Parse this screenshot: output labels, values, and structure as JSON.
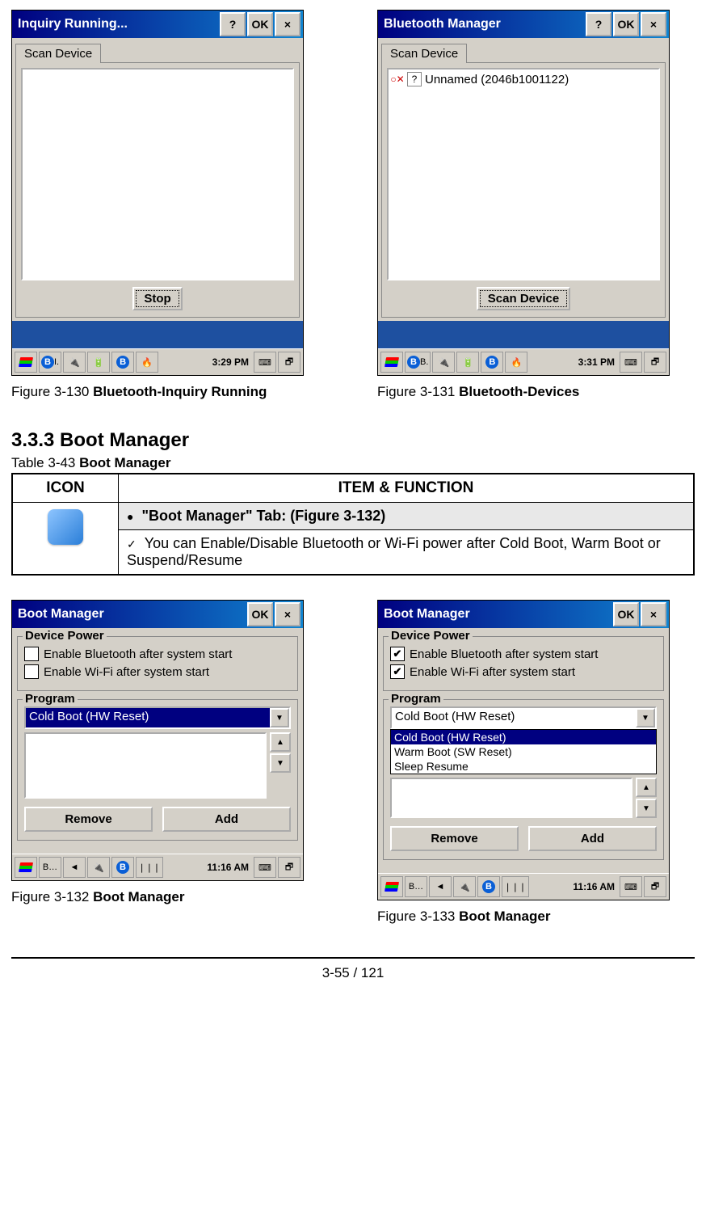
{
  "figures_top": {
    "left": {
      "title": "Inquiry Running...",
      "tab": "Scan Device",
      "main_button": "Stop",
      "time": "3:29 PM",
      "taskbar_text": "I.",
      "caption_prefix": "Figure 3-130 ",
      "caption_bold": "Bluetooth-Inquiry Running"
    },
    "right": {
      "title": "Bluetooth Manager",
      "tab": "Scan Device",
      "list_item": "Unnamed (2046b1001122)",
      "main_button": "Scan Device",
      "time": "3:31 PM",
      "taskbar_text": "B.",
      "caption_prefix": "Figure 3-131 ",
      "caption_bold": "Bluetooth-Devices"
    },
    "btn_help": "?",
    "btn_ok": "OK",
    "btn_close": "×"
  },
  "section": {
    "heading": "3.3.3 Boot Manager",
    "table_caption_prefix": "Table 3-43 ",
    "table_caption_bold": "Boot Manager",
    "col_icon": "ICON",
    "col_item": "ITEM & FUNCTION",
    "tab_title": "\"Boot Manager\" Tab: (Figure 3-132)",
    "desc": "You can Enable/Disable Bluetooth or Wi-Fi power after Cold Boot, Warm Boot or Suspend/Resume"
  },
  "bm": {
    "title": "Boot Manager",
    "btn_ok": "OK",
    "btn_close": "×",
    "group_device": "Device Power",
    "chk_bt": "Enable Bluetooth after system start",
    "chk_wifi": "Enable Wi-Fi after system start",
    "group_program": "Program",
    "dd_selected": "Cold Boot (HW Reset)",
    "dd_options": [
      "Cold Boot (HW Reset)",
      "Warm Boot (SW Reset)",
      "Sleep Resume"
    ],
    "btn_remove": "Remove",
    "btn_add": "Add",
    "time": "11:16 AM",
    "tb_text": "B…",
    "left_checked": false,
    "right_checked": true,
    "caption_left_prefix": "Figure 3-132 ",
    "caption_left_bold": "Boot Manager",
    "caption_right_prefix": "Figure 3-133 ",
    "caption_right_bold": "Boot Manager"
  },
  "footer": "3-55 / 121"
}
